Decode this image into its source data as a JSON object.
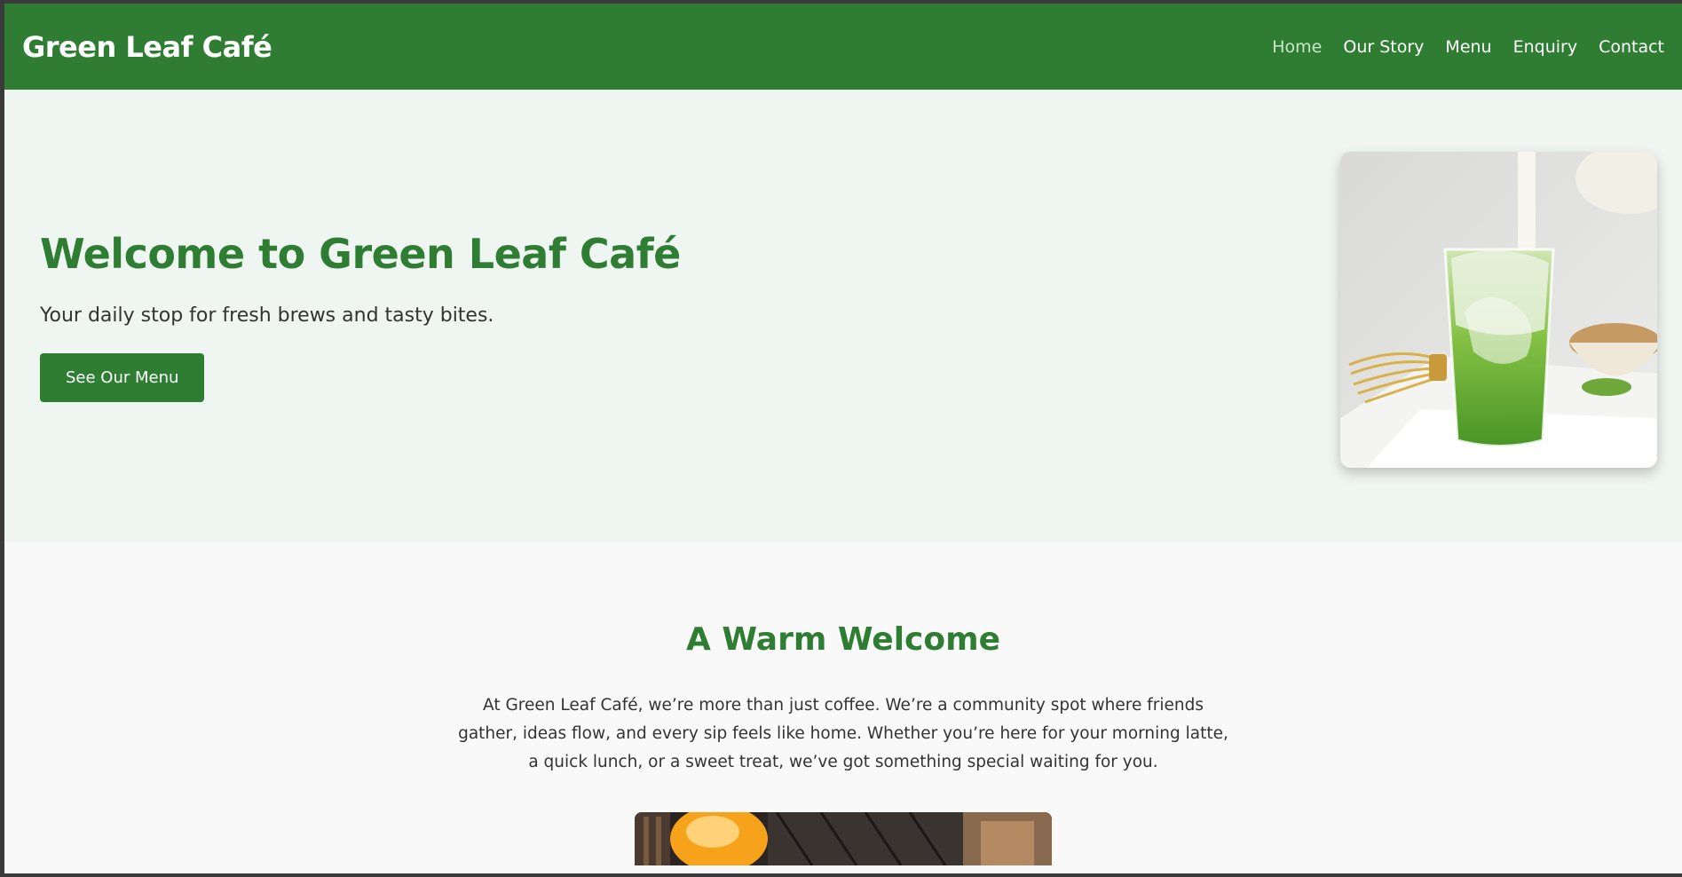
{
  "header": {
    "brand": "Green Leaf Café",
    "nav": [
      {
        "label": "Home",
        "active": true
      },
      {
        "label": "Our Story",
        "active": false
      },
      {
        "label": "Menu",
        "active": false
      },
      {
        "label": "Enquiry",
        "active": false
      },
      {
        "label": "Contact",
        "active": false
      }
    ]
  },
  "hero": {
    "title": "Welcome to Green Leaf Café",
    "subtitle": "Your daily stop for fresh brews and tasty bites.",
    "button_label": "See Our Menu",
    "image_icon": "iced-matcha-latte-photo"
  },
  "welcome": {
    "title": "A Warm Welcome",
    "text": "At Green Leaf Café, we’re more than just coffee. We’re a community spot where friends gather, ideas flow, and every sip feels like home. Whether you’re here for your morning latte, a quick lunch, or a sweet treat, we’ve got something special waiting for you.",
    "image_icon": "cafe-interior-photo"
  },
  "colors": {
    "primary": "#2e7d32",
    "hero_bg": "#eff5f1",
    "page_bg": "#f8f9f8",
    "nav_active": "#c8e6c9"
  }
}
